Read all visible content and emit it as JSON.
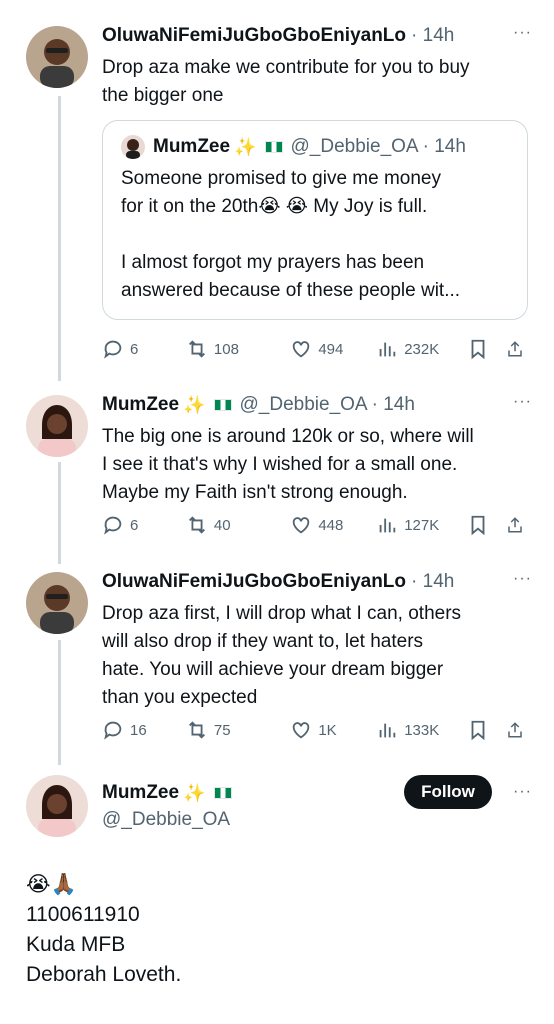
{
  "tweets": [
    {
      "display_name": "OluwaNiFemiJuGboGboEniyanLo",
      "time": "· 14h",
      "more": "···",
      "text": "Drop aza make we contribute for you to buy\nthe bigger one",
      "quote": {
        "display_name": "MumZee",
        "sparkle": "✨",
        "handle": "@_Debbie_OA",
        "time": "· 14h",
        "text": "Someone promised to give me money\nfor it on the 20th😭 😭 My Joy is full.\n\nI almost forgot my prayers has been\nanswered because of these people wit..."
      },
      "stats": {
        "replies": "6",
        "retweets": "108",
        "likes": "494",
        "views": "232K"
      }
    },
    {
      "display_name": "MumZee",
      "sparkle": "✨",
      "handle": "@_Debbie_OA",
      "time": "· 14h",
      "more": "···",
      "text": "The big one is around 120k or so, where will\nI see it that's why I wished for a small one.\nMaybe my Faith isn't strong enough.",
      "stats": {
        "replies": "6",
        "retweets": "40",
        "likes": "448",
        "views": "127K"
      }
    },
    {
      "display_name": "OluwaNiFemiJuGboGboEniyanLo",
      "time": "· 14h",
      "more": "···",
      "text": "Drop aza first, I will drop what I can, others\nwill also drop if they want to, let haters\nhate. You will achieve your dream bigger\nthan you expected",
      "stats": {
        "replies": "16",
        "retweets": "75",
        "likes": "1K",
        "views": "133K"
      }
    }
  ],
  "main_post": {
    "display_name": "MumZee",
    "sparkle": "✨",
    "handle": "@_Debbie_OA",
    "follow_label": "Follow",
    "more": "···",
    "text": "😭🙏🏾\n1100611910\nKuda MFB\nDeborah Loveth."
  },
  "icons": [
    "reply-icon",
    "retweet-icon",
    "like-icon",
    "views-icon",
    "bookmark-icon",
    "share-icon",
    "more-icon"
  ],
  "colors": {
    "text": "#0f1419",
    "muted": "#536471",
    "border": "#cfd9de",
    "follow_bg": "#0f1419"
  }
}
